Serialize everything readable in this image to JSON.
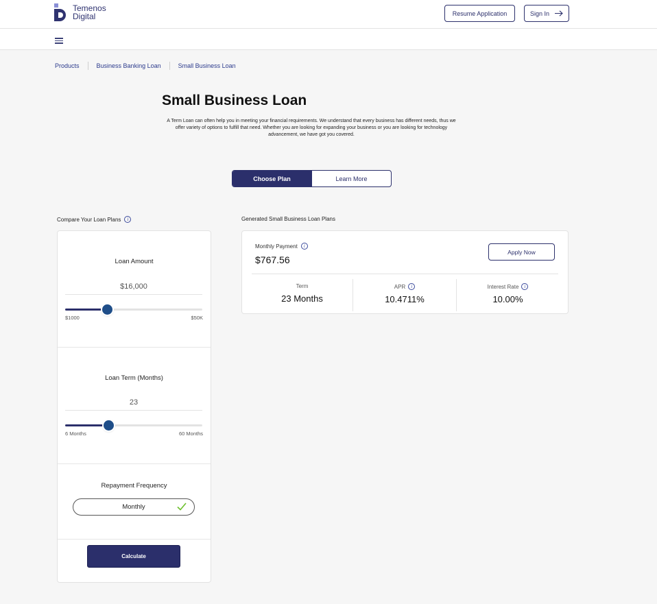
{
  "brand": {
    "line1": "Temenos",
    "line2": "Digital",
    "color": "#2b2f6b"
  },
  "header": {
    "resume_label": "Resume Application",
    "signin_label": "Sign In"
  },
  "breadcrumb": [
    "Products",
    "Business Banking Loan",
    "Small Business Loan"
  ],
  "page": {
    "title": "Small Business Loan",
    "description": "A Term Loan can often help you in meeting your financial requirements. We understand that every business has different needs, thus we offer variety of options to fulfill that need. Whether you are looking for expanding your business or you are looking for technology advancement, we have got you covered."
  },
  "tabs": {
    "active": "Choose Plan",
    "inactive": "Learn More"
  },
  "compare": {
    "label": "Compare Your Loan Plans",
    "loan_amount": {
      "title": "Loan Amount",
      "value": "$16,000",
      "min": "$1000",
      "max": "$50K",
      "fraction": 0.306
    },
    "loan_term": {
      "title": "Loan Term (Months)",
      "value": "23",
      "min": "6 Months",
      "max": "60 Months",
      "fraction": 0.315
    },
    "repayment": {
      "title": "Repayment Frequency",
      "value": "Monthly"
    },
    "calculate_label": "Calculate"
  },
  "plans": {
    "label": "Generated Small Business Loan Plans",
    "monthly_payment_label": "Monthly Payment",
    "monthly_payment": "$767.56",
    "apply_label": "Apply Now",
    "term_label": "Term",
    "term_value": "23 Months",
    "apr_label": "APR",
    "apr_value": "10.4711%",
    "rate_label": "Interest Rate",
    "rate_value": "10.00%"
  }
}
